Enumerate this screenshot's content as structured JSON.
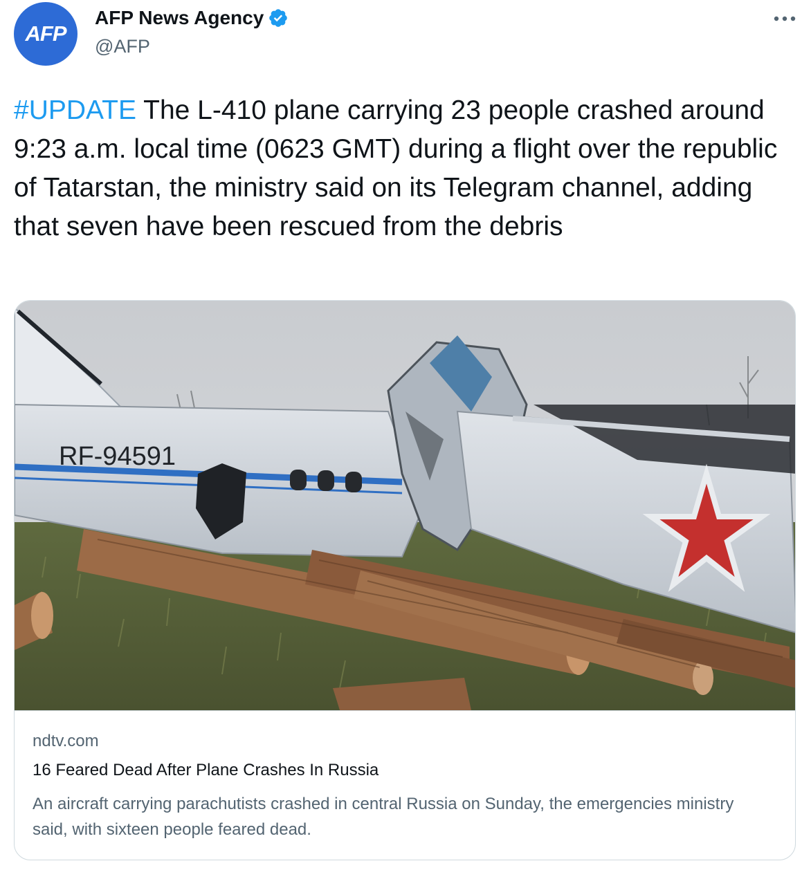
{
  "account": {
    "avatar_text": "AFP",
    "display_name": "AFP News Agency",
    "handle": "@AFP",
    "verified": true,
    "avatar_color": "#2d6bd6",
    "verified_color": "#1d9bf0"
  },
  "menu_icon": "more-horizontal-icon",
  "tweet": {
    "hashtag": "#UPDATE",
    "body": " The L-410 plane carrying 23 people crashed around 9:23 a.m. local time (0623 GMT) during a flight over the republic of Tatarstan, the ministry said on its Telegram channel, adding that seven have been rescued from the debris"
  },
  "link_card": {
    "image_registration": "RF-94591",
    "domain": "ndtv.com",
    "title": "16 Feared Dead After Plane Crashes In Russia",
    "description": "An aircraft carrying parachutists crashed in central Russia on Sunday, the emergencies ministry said, with sixteen people feared dead."
  },
  "colors": {
    "link": "#1d9bf0",
    "secondary_text": "#536471",
    "border": "#cfd9de"
  }
}
